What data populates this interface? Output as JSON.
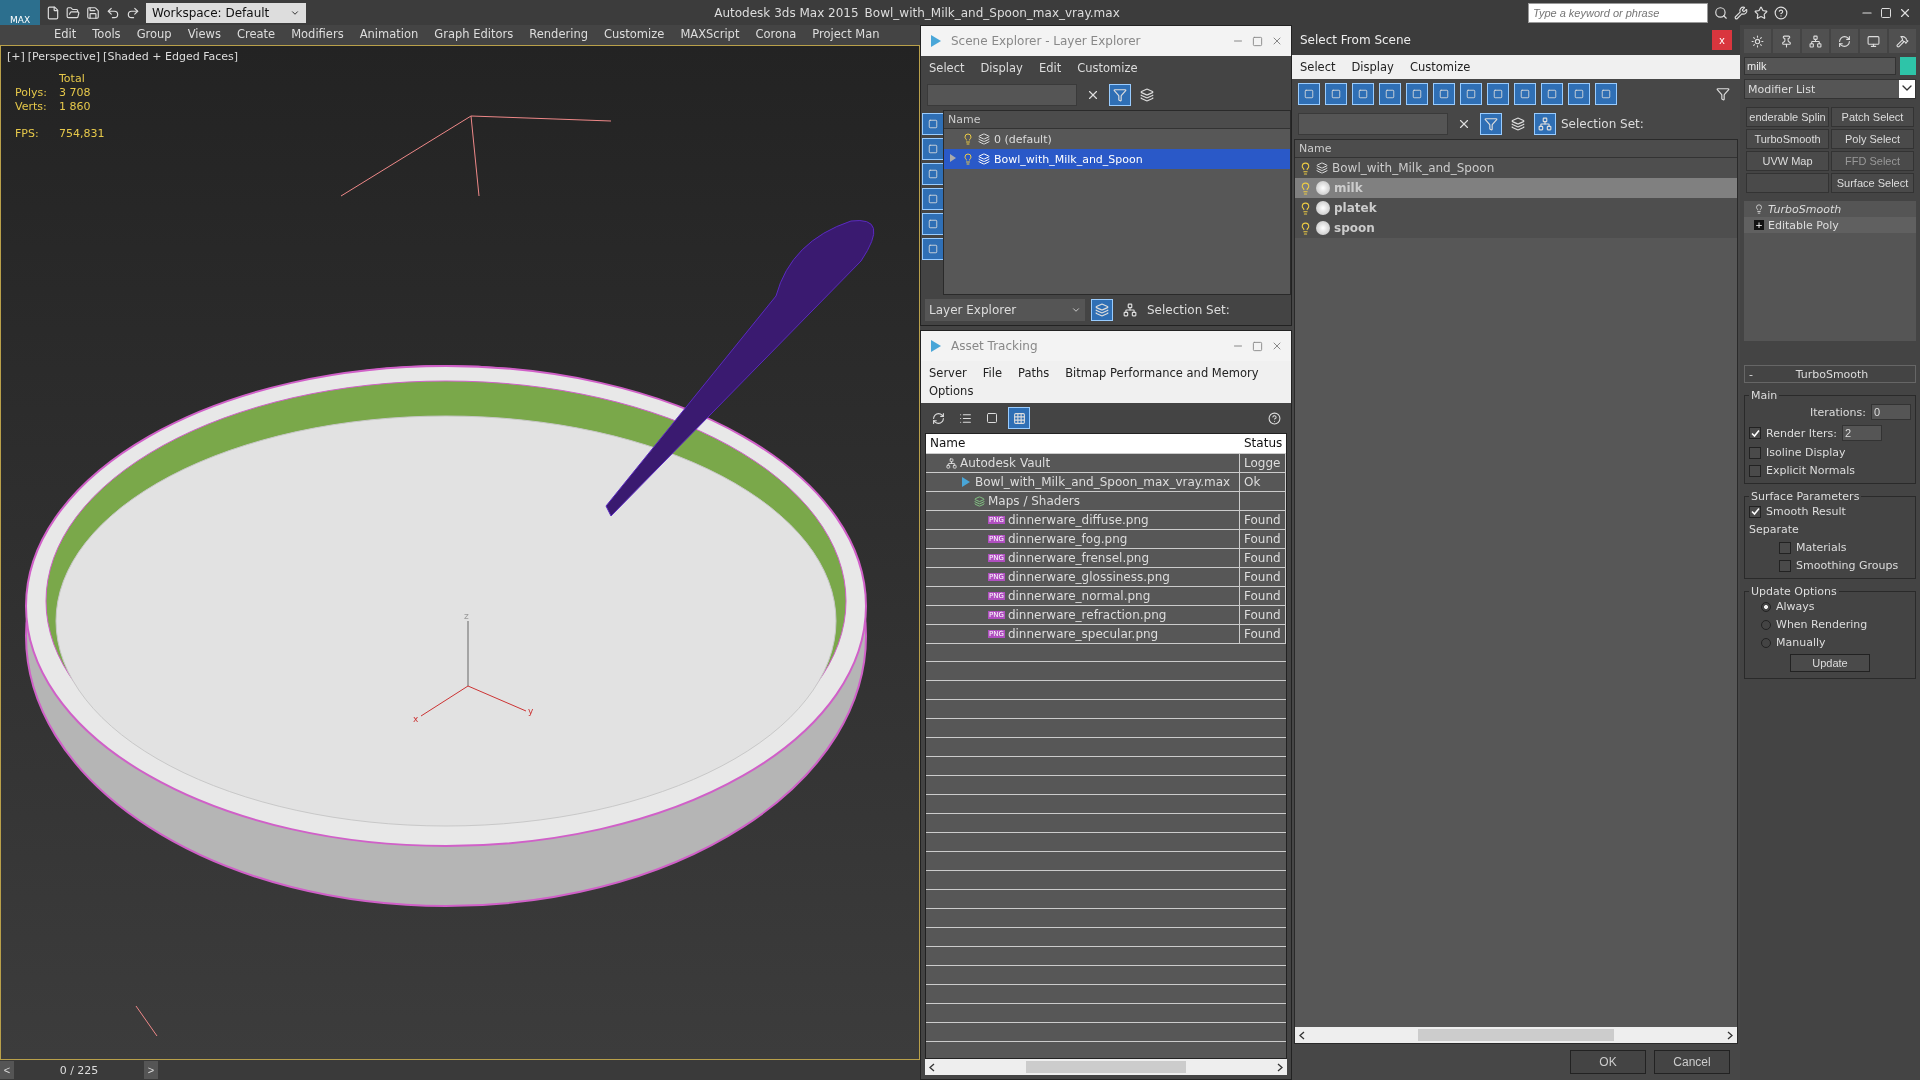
{
  "title_bar": {
    "logo_label": "MAX",
    "workspace": "Workspace: Default",
    "app_title": "Autodesk 3ds Max  2015",
    "file_name": "Bowl_with_Milk_and_Spoon_max_vray.max",
    "search_placeholder": "Type a keyword or phrase"
  },
  "menu": [
    "Edit",
    "Tools",
    "Group",
    "Views",
    "Create",
    "Modifiers",
    "Animation",
    "Graph Editors",
    "Rendering",
    "Customize",
    "MAXScript",
    "Corona",
    "Project Man"
  ],
  "viewport": {
    "labels": [
      "[+]",
      "[Perspective]",
      "[Shaded + Edged Faces]"
    ],
    "stats_header": "Total",
    "stats": [
      {
        "label": "Polys:",
        "value": "3 708"
      },
      {
        "label": "Verts:",
        "value": "1 860"
      }
    ],
    "fps_label": "FPS:",
    "fps_value": "754,831",
    "gizmo_axes": [
      "x",
      "y",
      "z"
    ]
  },
  "timeline": {
    "prev": "<",
    "position": "0 / 225",
    "next": ">"
  },
  "scene_explorer": {
    "title": "Scene Explorer - Layer Explorer",
    "menu": [
      "Select",
      "Display",
      "Edit",
      "Customize"
    ],
    "column": "Name",
    "rows": [
      {
        "name": "0 (default)",
        "selected": false
      },
      {
        "name": "Bowl_with_Milk_and_Spoon",
        "selected": true,
        "expanded": false
      }
    ],
    "footer_dropdown": "Layer Explorer",
    "selection_set_label": "Selection Set:"
  },
  "asset_tracking": {
    "title": "Asset Tracking",
    "menu": [
      "Server",
      "File",
      "Paths",
      "Bitmap Performance and Memory",
      "Options"
    ],
    "columns": [
      "Name",
      "Status"
    ],
    "rows": [
      {
        "kind": "vault",
        "name": "Autodesk Vault",
        "status": "Logge",
        "children": [
          {
            "kind": "max",
            "name": "Bowl_with_Milk_and_Spoon_max_vray.max",
            "status": "Ok",
            "children": [
              {
                "kind": "folder",
                "name": "Maps / Shaders",
                "children": [
                  {
                    "kind": "png",
                    "icon_text": "PNG",
                    "name": "dinnerware_diffuse.png",
                    "status": "Found"
                  },
                  {
                    "kind": "png",
                    "icon_text": "PNG",
                    "name": "dinnerware_fog.png",
                    "status": "Found"
                  },
                  {
                    "kind": "png",
                    "icon_text": "PNG",
                    "name": "dinnerware_frensel.png",
                    "status": "Found"
                  },
                  {
                    "kind": "png",
                    "icon_text": "PNG",
                    "name": "dinnerware_glossiness.png",
                    "status": "Found"
                  },
                  {
                    "kind": "png",
                    "icon_text": "PNG",
                    "name": "dinnerware_normal.png",
                    "status": "Found"
                  },
                  {
                    "kind": "png",
                    "icon_text": "PNG",
                    "name": "dinnerware_refraction.png",
                    "status": "Found"
                  },
                  {
                    "kind": "png",
                    "icon_text": "PNG",
                    "name": "dinnerware_specular.png",
                    "status": "Found"
                  }
                ]
              }
            ]
          }
        ]
      }
    ]
  },
  "select_from_scene": {
    "title": "Select From Scene",
    "close": "x",
    "menu": [
      "Select",
      "Display",
      "Customize"
    ],
    "selection_set_label": "Selection Set:",
    "column": "Name",
    "rows": [
      {
        "kind": "group",
        "name": "Bowl_with_Milk_and_Spoon",
        "selected": false
      },
      {
        "kind": "object",
        "name": "milk",
        "selected": true
      },
      {
        "kind": "object",
        "name": "platek",
        "selected": false
      },
      {
        "kind": "object",
        "name": "spoon",
        "selected": false
      }
    ],
    "buttons": [
      "OK",
      "Cancel"
    ]
  },
  "command_panel": {
    "object_name": "milk",
    "modifier_list": "Modifier List",
    "modifier_buttons": [
      {
        "kind": "button",
        "label": "enderable Splin",
        "disabled": false
      },
      {
        "kind": "button",
        "label": "Patch Select",
        "disabled": false
      },
      {
        "kind": "button",
        "label": "TurboSmooth",
        "disabled": false
      },
      {
        "kind": "button",
        "label": "Poly Select",
        "disabled": false
      },
      {
        "kind": "button",
        "label": "UVW Map",
        "disabled": false
      },
      {
        "kind": "button",
        "label": "FFD Select",
        "disabled": true
      },
      {
        "kind": "blank"
      },
      {
        "kind": "button",
        "label": "Surface Select",
        "disabled": false
      }
    ],
    "stack": [
      {
        "kind": "modifier",
        "label": "TurboSmooth"
      },
      {
        "kind": "base",
        "label": "Editable Poly",
        "sign": "+"
      }
    ],
    "rollout": {
      "collapse": "-",
      "title": "TurboSmooth",
      "main": {
        "title": "Main",
        "iterations_label": "Iterations:",
        "iterations": "0",
        "render_iters_label": "Render Iters:",
        "render_iters_checked": true,
        "render_iters": "2",
        "options": [
          {
            "label": "Isoline Display",
            "checked": false
          },
          {
            "label": "Explicit Normals",
            "checked": false
          }
        ]
      },
      "surface": {
        "title": "Surface Parameters",
        "smooth_result": {
          "label": "Smooth Result",
          "checked": true
        },
        "separate_label": "Separate",
        "separate": [
          {
            "label": "Materials",
            "checked": false
          },
          {
            "label": "Smoothing Groups",
            "checked": false
          }
        ]
      },
      "update": {
        "title": "Update Options",
        "radios": [
          {
            "label": "Always",
            "selected": true
          },
          {
            "label": "When Rendering",
            "selected": false
          },
          {
            "label": "Manually",
            "selected": false
          }
        ],
        "button": "Update"
      }
    }
  }
}
